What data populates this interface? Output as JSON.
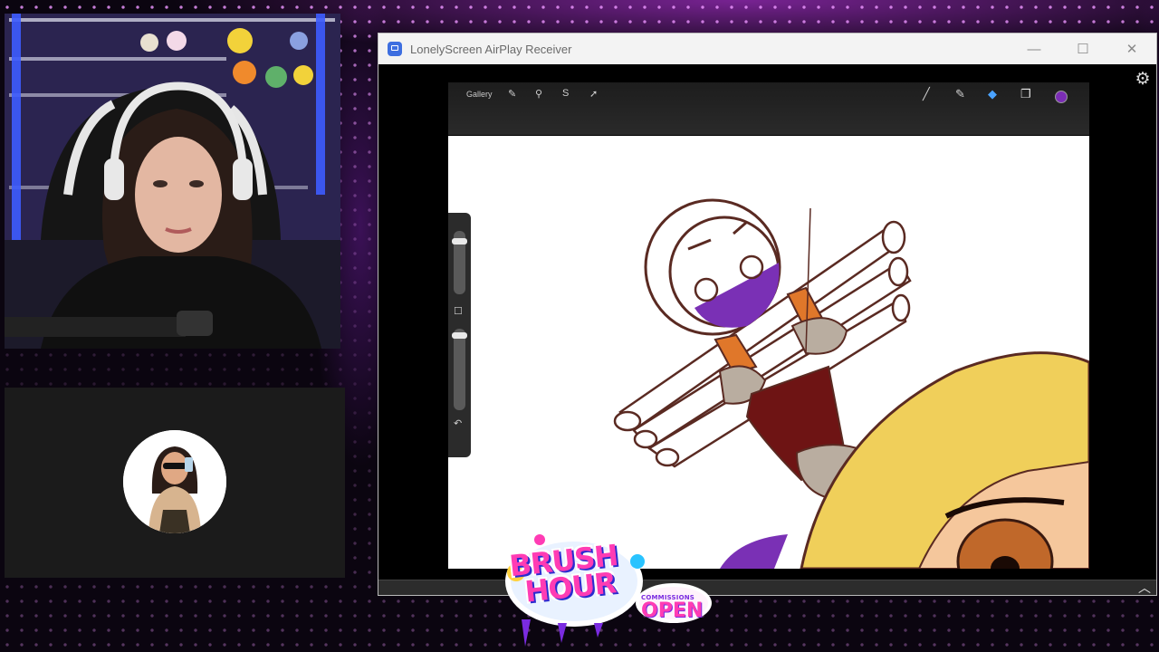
{
  "window": {
    "title": "LonelyScreen AirPlay Receiver",
    "minimize": "—",
    "maximize": "☐",
    "close": "✕",
    "settings_icon": "gear-icon",
    "settings_glyph": "⚙",
    "scroll_glyph": "︿"
  },
  "procreate": {
    "gallery": "Gallery",
    "tools_left": [
      "wrench-icon",
      "magic-wand-icon",
      "selection-icon",
      "transform-icon"
    ],
    "tools_left_glyphs": [
      "✎",
      "⚲",
      "S",
      "➚"
    ],
    "tools_right": [
      "brush-icon",
      "smudge-icon",
      "eraser-icon",
      "layers-icon"
    ],
    "tools_right_glyphs": [
      "╱",
      "✎",
      "◆",
      "❐"
    ],
    "tools_right_colors": [
      "#cfcfcf",
      "#cfcfcf",
      "#4aa3ff",
      "#e8e8e8"
    ],
    "active_color": "#7b2db5",
    "sidebar_modify": "☐",
    "sidebar_undo": "↶"
  },
  "overlay": {
    "logo_line1": "BRUSH",
    "logo_line2": "HOUR",
    "badge_small": "COMMISSIONS",
    "badge_big": "OPEN"
  }
}
